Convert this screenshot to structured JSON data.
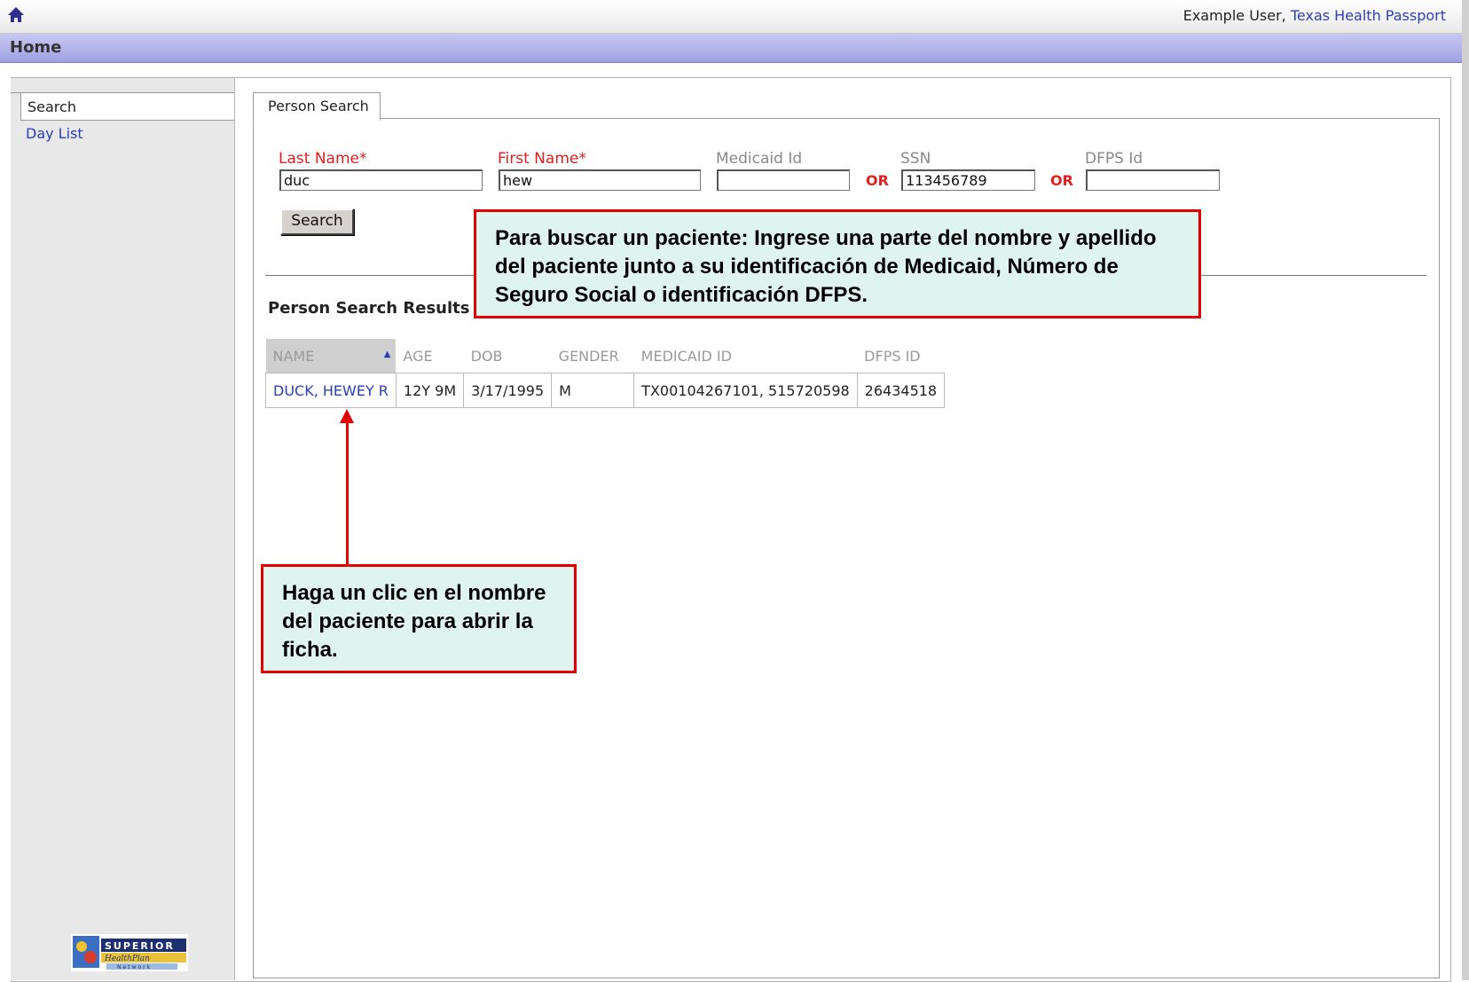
{
  "header": {
    "user_name": "Example User,",
    "org_link": "Texas Health Passport",
    "section_title": "Home"
  },
  "sidebar": {
    "items": [
      {
        "label": "Search"
      },
      {
        "label": "Day List"
      }
    ],
    "logo_text": "SUPERIOR HealthPlan Network"
  },
  "person_search": {
    "tab_label": "Person Search",
    "fields": {
      "last_name": {
        "label": "Last Name*",
        "value": "duc"
      },
      "first_name": {
        "label": "First Name*",
        "value": "hew"
      },
      "medicaid_id": {
        "label": "Medicaid Id",
        "value": ""
      },
      "ssn": {
        "label": "SSN",
        "value": "113456789"
      },
      "dfps_id": {
        "label": "DFPS Id",
        "value": ""
      }
    },
    "or_text": "OR",
    "search_button": "Search"
  },
  "results": {
    "title": "Person Search Results",
    "columns": [
      "NAME",
      "AGE",
      "DOB",
      "GENDER",
      "MEDICAID ID",
      "DFPS ID"
    ],
    "rows": [
      {
        "name": "DUCK, HEWEY R",
        "age": "12Y 9M",
        "dob": "3/17/1995",
        "gender": "M",
        "medicaid_id": "TX00104267101, 515720598",
        "dfps_id": "26434518"
      }
    ]
  },
  "callouts": {
    "search_help": "Para buscar un paciente:  Ingrese una parte del nombre y apellido del paciente  junto a su identificación de Medicaid, Número de Seguro Social o identificación DFPS.",
    "click_help": "Haga un clic en el nombre del paciente para abrir la ficha."
  },
  "colors": {
    "accent_link": "#2a3fb5",
    "required_red": "#e02020",
    "callout_border": "#e00000",
    "callout_bg": "#dff4ef",
    "header_band": "#a9abe6"
  }
}
